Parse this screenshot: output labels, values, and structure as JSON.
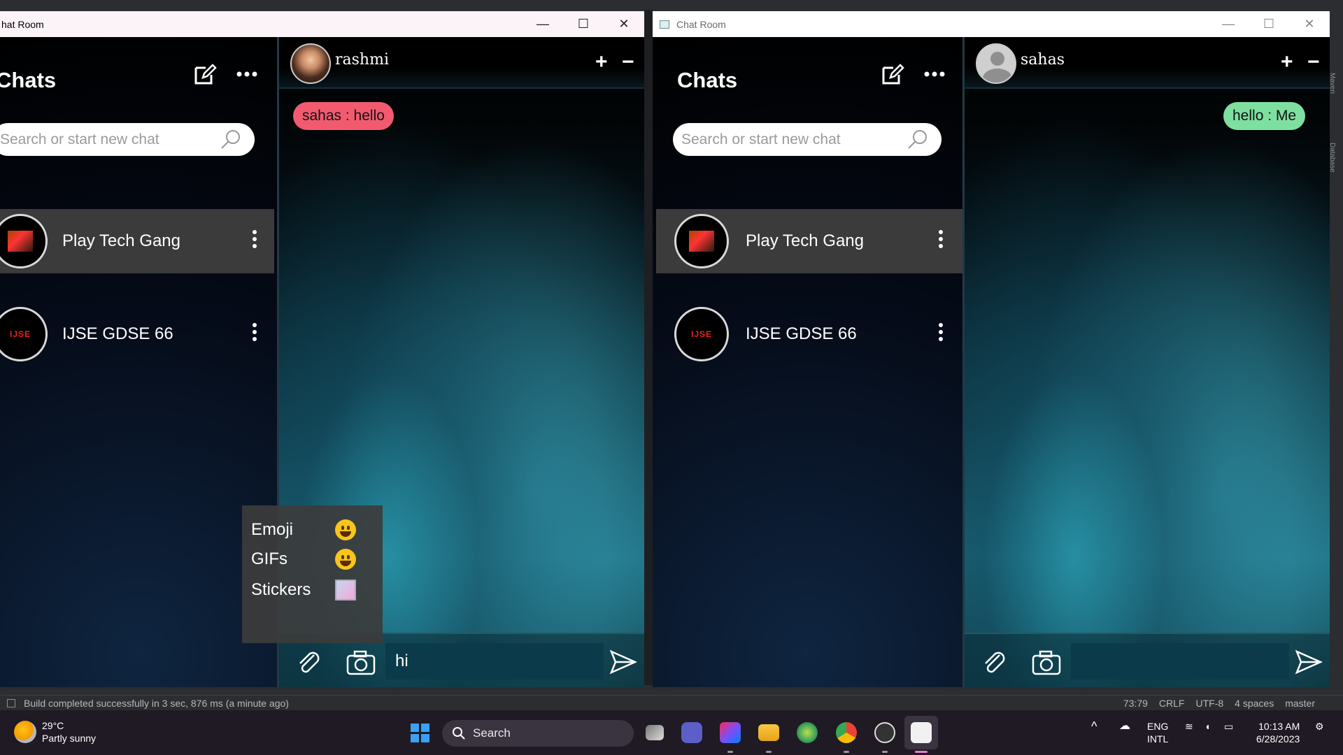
{
  "left_window": {
    "title": "hat Room",
    "controls": {
      "minimize": "—",
      "maximize": "☐",
      "close": "✕"
    },
    "sidebar": {
      "title": "Chats",
      "search_placeholder": "Search or start new chat",
      "chats": [
        {
          "name": "Play Tech Gang",
          "active": true
        },
        {
          "name": "IJSE GDSE 66",
          "active": false
        }
      ]
    },
    "chat": {
      "contact": "rashmi",
      "messages": [
        {
          "text": "sahas : hello",
          "direction": "received",
          "color": "#f25a70"
        }
      ],
      "input_value": "hi"
    },
    "emoji_menu": {
      "items": [
        {
          "label": "Emoji",
          "icon": "grinning-face-icon"
        },
        {
          "label": "GIFs",
          "icon": "beaming-face-icon"
        },
        {
          "label": "Stickers",
          "icon": "sticker-icon"
        }
      ]
    }
  },
  "right_window": {
    "title": "Chat Room",
    "controls": {
      "minimize": "—",
      "maximize": "☐",
      "close": "✕"
    },
    "sidebar": {
      "title": "Chats",
      "search_placeholder": "Search or start new chat",
      "chats": [
        {
          "name": "Play Tech Gang",
          "active": true
        },
        {
          "name": "IJSE GDSE 66",
          "active": false
        }
      ]
    },
    "chat": {
      "contact": "sahas",
      "messages": [
        {
          "text": "hello : Me",
          "direction": "sent",
          "color": "#7ee0a0"
        }
      ],
      "input_value": ""
    }
  },
  "ide_status": {
    "build_message": "Build completed successfully in 3 sec, 876 ms (a minute ago)",
    "position": "73:79",
    "line_sep": "CRLF",
    "encoding": "UTF-8",
    "indent": "4 spaces",
    "branch": "master"
  },
  "ide_side_labels": {
    "maven": "Maven",
    "database": "Database"
  },
  "taskbar": {
    "weather_temp": "29°C",
    "weather_desc": "Partly sunny",
    "search_label": "Search",
    "lang_1": "ENG",
    "lang_2": "INTL",
    "time": "10:13 AM",
    "date": "6/28/2023"
  },
  "colors": {
    "received_bubble": "#f25a70",
    "sent_bubble": "#7ee0a0",
    "input_bg": "#0b3a4a"
  }
}
